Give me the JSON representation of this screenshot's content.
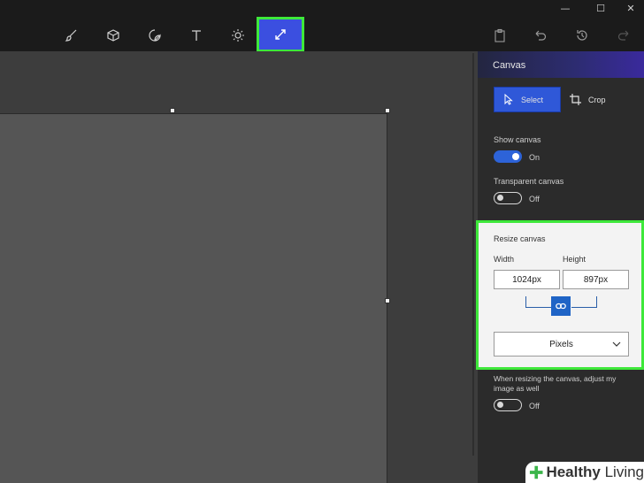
{
  "window_controls": {
    "minimize": "—",
    "maximize": "☐",
    "close": "✕"
  },
  "toolbar": {
    "tools": [
      "brush-icon",
      "3d-cube-icon",
      "sticker-icon",
      "text-icon",
      "effects-sun-icon",
      "canvas-resize-icon"
    ],
    "active_tool": "canvas-resize-icon",
    "right_actions": [
      "paste-icon",
      "undo-icon",
      "history-icon",
      "redo-icon"
    ]
  },
  "panel": {
    "title": "Canvas",
    "select_label": "Select",
    "crop_label": "Crop",
    "show_canvas_label": "Show canvas",
    "show_canvas_state": "On",
    "transparent_label": "Transparent canvas",
    "transparent_state": "Off",
    "resize": {
      "title": "Resize canvas",
      "width_label": "Width",
      "height_label": "Height",
      "width_value": "1024px",
      "height_value": "897px",
      "units": "Pixels"
    },
    "adjust_image_label": "When resizing the canvas, adjust my image as well",
    "adjust_image_state": "Off"
  },
  "watermark": {
    "brand_bold": "Healthy",
    "brand_regular": " Living"
  },
  "colors": {
    "accent": "#2f58d8",
    "highlight_green": "#3ee83a",
    "panel_bg": "#2b2b2b",
    "workspace_bg": "#3d3d3d"
  }
}
